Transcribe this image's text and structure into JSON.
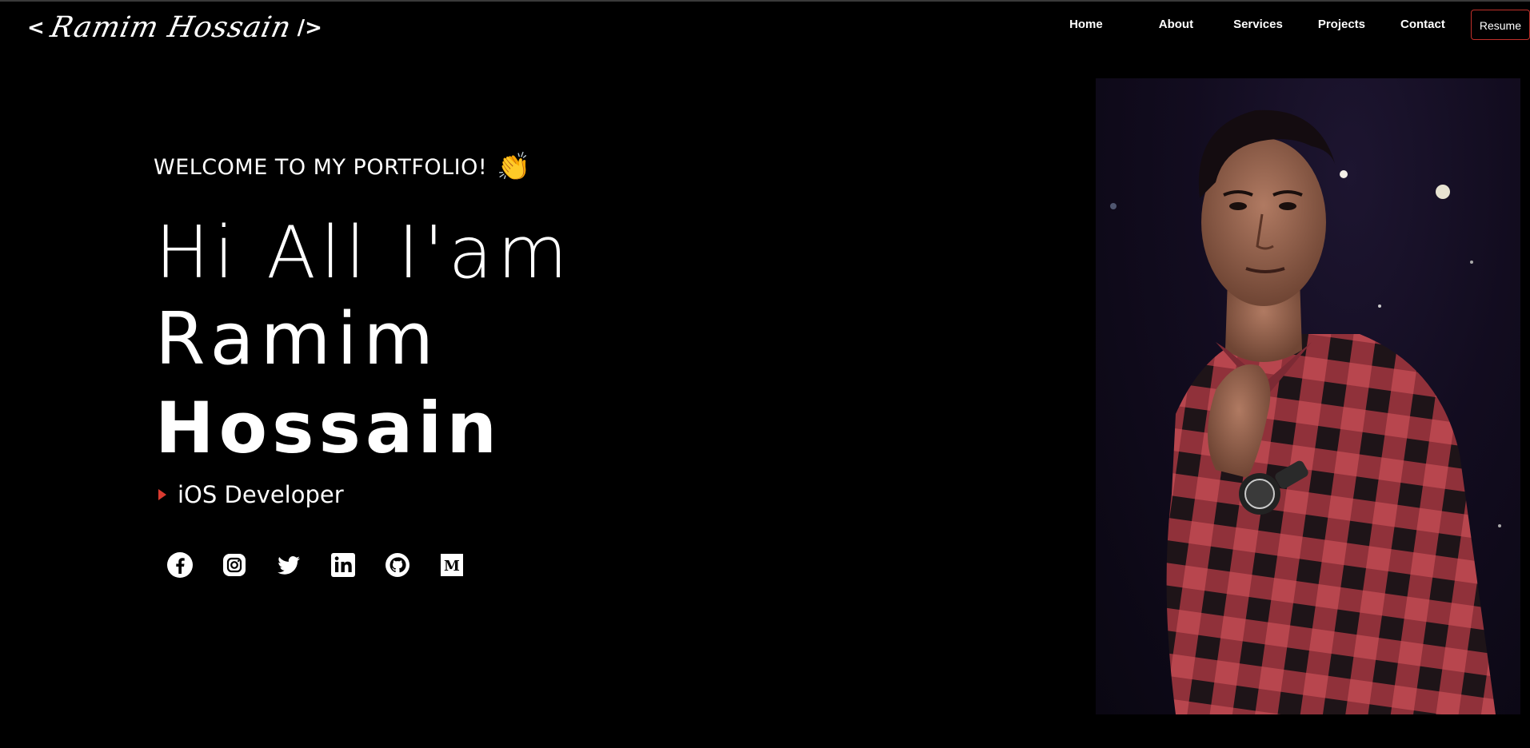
{
  "logo": {
    "open": "<",
    "name": "Ramim Hossain",
    "close": "/>"
  },
  "nav": {
    "items": [
      "Home",
      "About",
      "Services",
      "Projects",
      "Contact"
    ],
    "resume_label": "Resume"
  },
  "hero": {
    "welcome": "WELCOME TO MY PORTFOLIO!",
    "greeting": "Hi All I'am",
    "first_name": "Ramim",
    "last_name": "Hossain",
    "role": "iOS Developer"
  },
  "socials": [
    "facebook-icon",
    "instagram-icon",
    "twitter-icon",
    "linkedin-icon",
    "github-icon",
    "medium-icon"
  ],
  "colors": {
    "background": "#000000",
    "accent": "#d93a30",
    "text": "#ffffff"
  }
}
